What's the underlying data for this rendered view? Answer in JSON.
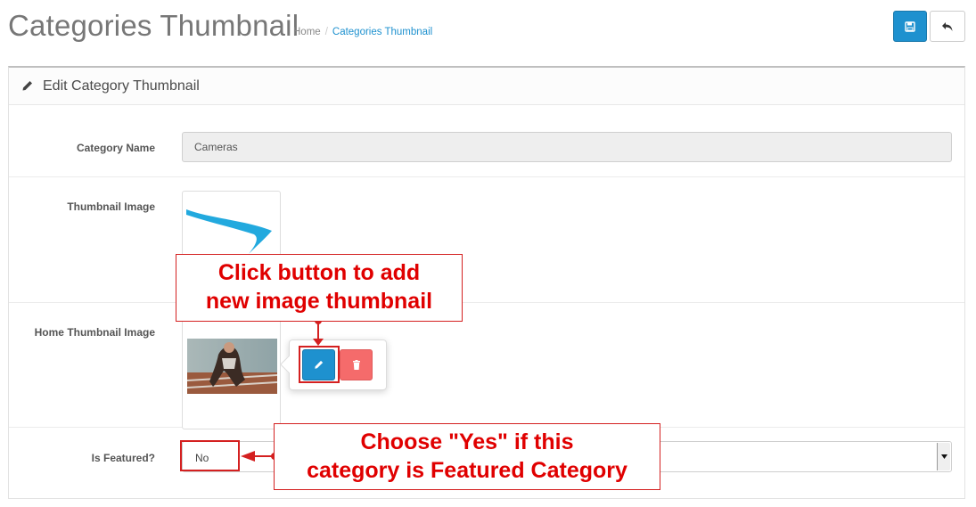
{
  "header": {
    "title": "Categories Thumbnail",
    "breadcrumb": {
      "home": "Home",
      "separator": "/",
      "current": "Categories Thumbnail"
    }
  },
  "panel": {
    "heading": "Edit Category Thumbnail"
  },
  "form": {
    "category_name": {
      "label": "Category Name",
      "value": "Cameras"
    },
    "thumbnail_image": {
      "label": "Thumbnail Image"
    },
    "home_thumbnail_image": {
      "label": "Home Thumbnail Image"
    },
    "is_featured": {
      "label": "Is Featured?",
      "selected": "No"
    }
  },
  "annotations": {
    "add_image": {
      "line1": "Click button to add",
      "line2": "new image thumbnail"
    },
    "featured": {
      "line1": "Choose \"Yes\" if this",
      "line2": "category is Featured Category"
    }
  },
  "colors": {
    "primary": "#1e91cf",
    "danger": "#f56b6b",
    "annotation": "#e00000"
  },
  "icons": [
    "save-icon",
    "reply-icon",
    "pencil-icon",
    "trash-icon",
    "caret-down-icon"
  ]
}
